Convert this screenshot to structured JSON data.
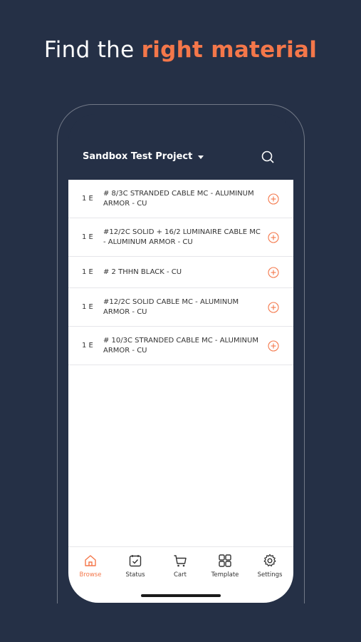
{
  "headline": {
    "plain": "Find the ",
    "accent": "right material"
  },
  "header": {
    "project_name": "Sandbox Test Project"
  },
  "items": [
    {
      "unit": "1 E",
      "description": "# 8/3C STRANDED CABLE MC - ALUMINUM ARMOR - CU"
    },
    {
      "unit": "1 E",
      "description": "#12/2C SOLID + 16/2 LUMINAIRE CABLE MC - ALUMINUM ARMOR - CU"
    },
    {
      "unit": "1 E",
      "description": "# 2 THHN BLACK - CU"
    },
    {
      "unit": "1 E",
      "description": "#12/2C SOLID CABLE MC - ALUMINUM ARMOR - CU"
    },
    {
      "unit": "1 E",
      "description": "# 10/3C STRANDED CABLE MC - ALUMINUM ARMOR - CU"
    }
  ],
  "tabs": [
    {
      "label": "Browse",
      "icon": "home-icon",
      "active": true
    },
    {
      "label": "Status",
      "icon": "calendar-check-icon",
      "active": false
    },
    {
      "label": "Cart",
      "icon": "cart-icon",
      "active": false
    },
    {
      "label": "Template",
      "icon": "grid-icon",
      "active": false
    },
    {
      "label": "Settings",
      "icon": "gear-icon",
      "active": false
    }
  ],
  "colors": {
    "accent": "#f4774a",
    "background": "#253046"
  }
}
